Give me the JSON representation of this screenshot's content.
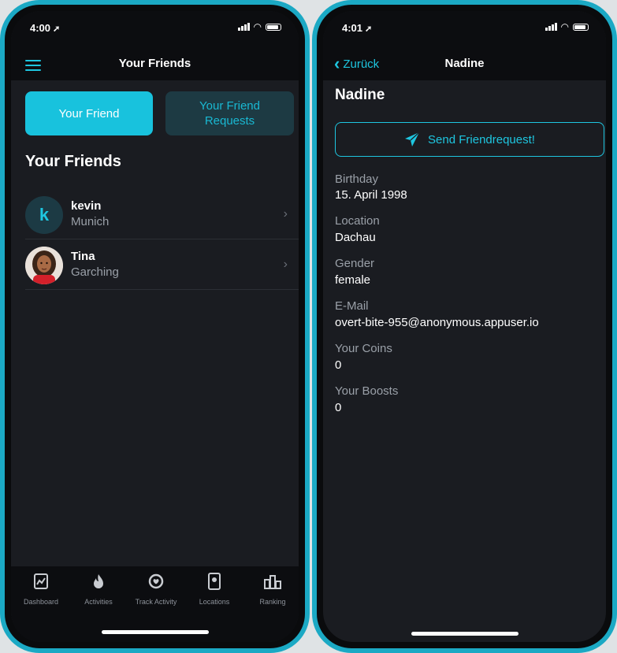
{
  "left_phone": {
    "status": {
      "time": "4:00"
    },
    "nav": {
      "title": "Your Friends"
    },
    "segments": {
      "active": "Your Friend",
      "inactive": "Your Friend Requests"
    },
    "section_title": "Your Friends",
    "friends": [
      {
        "initial": "k",
        "name": "kevin",
        "location": "Munich"
      },
      {
        "initial": "",
        "name": "Tina",
        "location": "Garching"
      }
    ],
    "tabs": [
      {
        "label": "Dashboard",
        "icon": "dashboard-icon"
      },
      {
        "label": "Activities",
        "icon": "flame-icon"
      },
      {
        "label": "Track Activity",
        "icon": "heart-rate-icon"
      },
      {
        "label": "Locations",
        "icon": "map-pin-icon"
      },
      {
        "label": "Ranking",
        "icon": "podium-icon"
      }
    ]
  },
  "right_phone": {
    "status": {
      "time": "4:01"
    },
    "nav": {
      "back_label": "Zurück",
      "title": "Nadine"
    },
    "profile": {
      "name": "Nadine",
      "send_button": "Send Friendrequest!",
      "fields": [
        {
          "label": "Birthday",
          "value": "15. April 1998"
        },
        {
          "label": "Location",
          "value": "Dachau"
        },
        {
          "label": "Gender",
          "value": "female"
        },
        {
          "label": "E-Mail",
          "value": "overt-bite-955@anonymous.appuser.io"
        },
        {
          "label": "Your Coins",
          "value": "0"
        },
        {
          "label": "Your Boosts",
          "value": "0"
        }
      ]
    }
  },
  "colors": {
    "accent": "#1ec6e0",
    "frame": "#1ba9c4",
    "background": "#1a1c21",
    "bar": "#0c0d10"
  }
}
